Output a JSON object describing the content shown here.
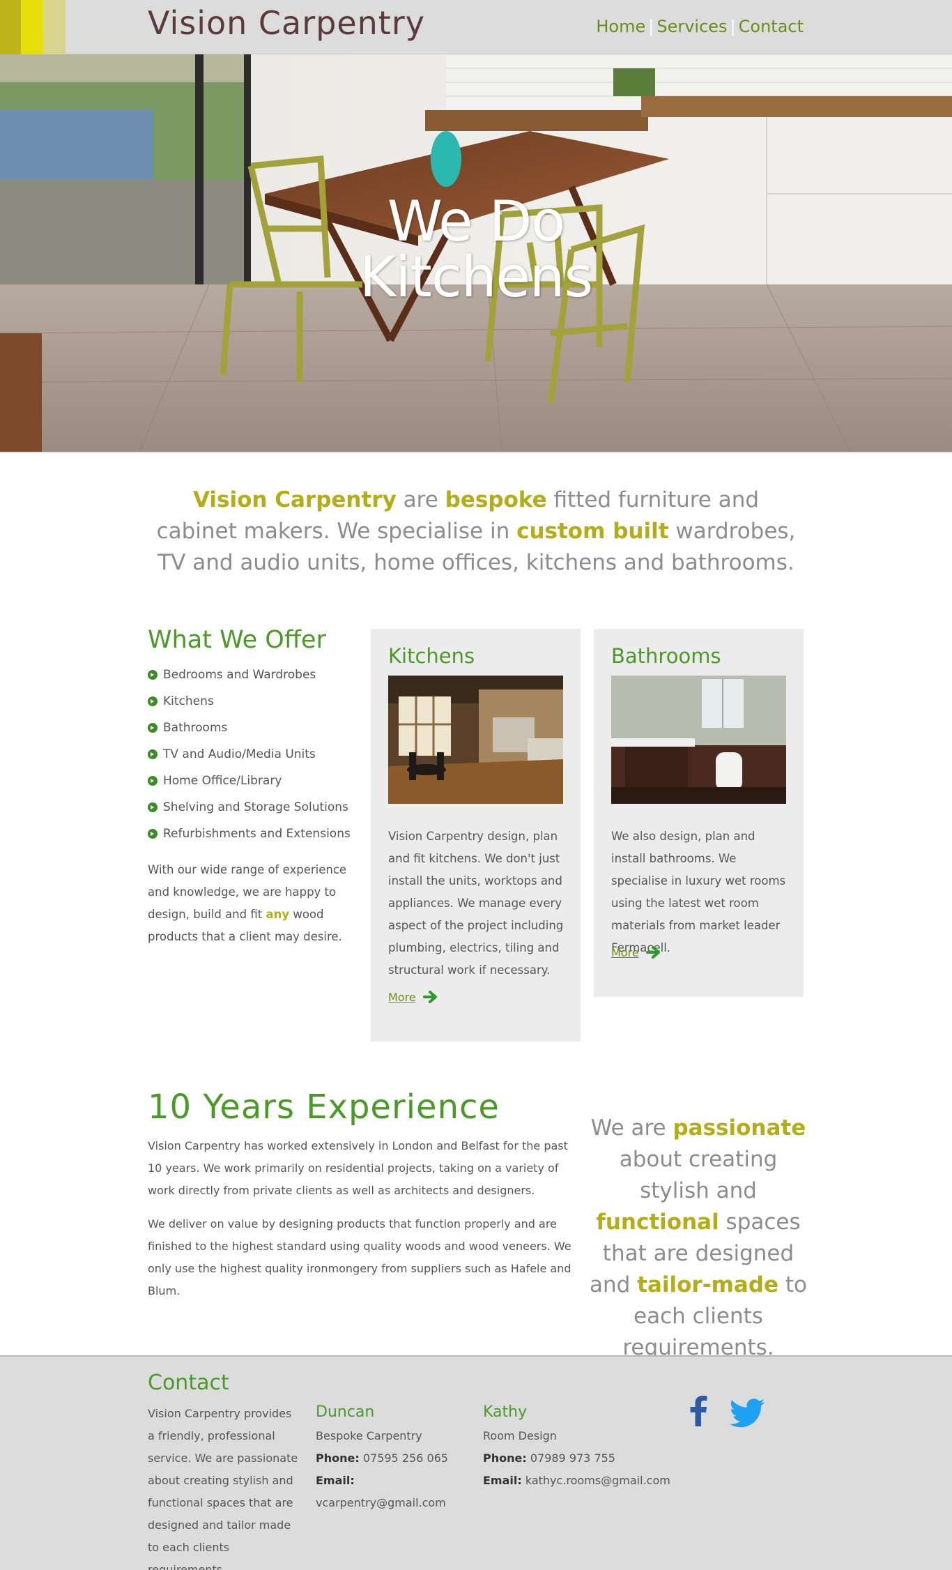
{
  "header": {
    "logo": "Vision Carpentry",
    "nav": [
      "Home",
      "Services",
      "Contact"
    ],
    "stripe_colors": [
      "#bdb51a",
      "#e7df0c",
      "#d9d58f"
    ]
  },
  "hero": {
    "line1": "We Do",
    "line2": "Kitchens"
  },
  "intro": {
    "p1": "Vision Carpentry",
    "p2": " are ",
    "p3": "bespoke",
    "p4": " fitted furniture and cabinet makers. We specialise in ",
    "p5": "custom built",
    "p6": " wardrobes, TV and audio units, home offices, kitchens and bathrooms."
  },
  "offer": {
    "title": "What We Offer",
    "items": [
      "Bedrooms and Wardrobes",
      "Kitchens",
      "Bathrooms",
      "TV and Audio/Media Units",
      "Home Office/Library",
      "Shelving and Storage Solutions",
      "Refurbishments and Extensions"
    ],
    "para_a": "With our wide range of experience and knowledge, we are happy to design, build and fit ",
    "para_hl": "any",
    "para_b": " wood products that a client may desire."
  },
  "cards": {
    "kitchens": {
      "title": "Kitchens",
      "text": "Vision Carpentry design, plan and fit kitchens. We don't just install the units, worktops and appliances. We manage every aspect of the project including plumbing, electrics, tiling and structural work if necessary.",
      "more": "More"
    },
    "bathrooms": {
      "title": "Bathrooms",
      "text": "We also design, plan and install bathrooms. We specialise in luxury wet rooms using the latest wet room materials from market leader Fermacell.",
      "more": "More"
    }
  },
  "experience": {
    "title": "10 Years Experience",
    "p1": "Vision Carpentry has worked extensively in London and Belfast for the past 10 years. We work primarily on residential projects, taking on a variety of work directly from private clients as well as architects and designers.",
    "p2": "We deliver on value by designing products that function properly and are finished to the highest standard using quality woods and wood veneers. We only use the highest quality ironmongery from suppliers such as Hafele and Blum."
  },
  "quote": {
    "q1": "We are ",
    "q2": "passionate",
    "q3": " about creating stylish and ",
    "q4": "functional",
    "q5": " spaces that are designed and ",
    "q6": "tailor-made",
    "q7": " to each clients requirements."
  },
  "footer": {
    "title": "Contact",
    "desc": "Vision Carpentry provides a friendly, professional service. We are passionate about creating stylish and functional spaces that are designed and tailor made to each clients requirements.",
    "duncan": {
      "name": "Duncan",
      "role": "Bespoke Carpentry",
      "phone_label": "Phone:",
      "phone": " 07595 256 065",
      "email_label": "Email:",
      "email": "vcarpentry@gmail.com"
    },
    "kathy": {
      "name": "Kathy",
      "role": "Room Design",
      "phone_label": "Phone:",
      "phone": " 07989 973 755",
      "email_label": "Email:",
      "email": " kathyc.rooms@gmail.com"
    },
    "social": [
      "facebook-icon",
      "twitter-icon"
    ]
  }
}
